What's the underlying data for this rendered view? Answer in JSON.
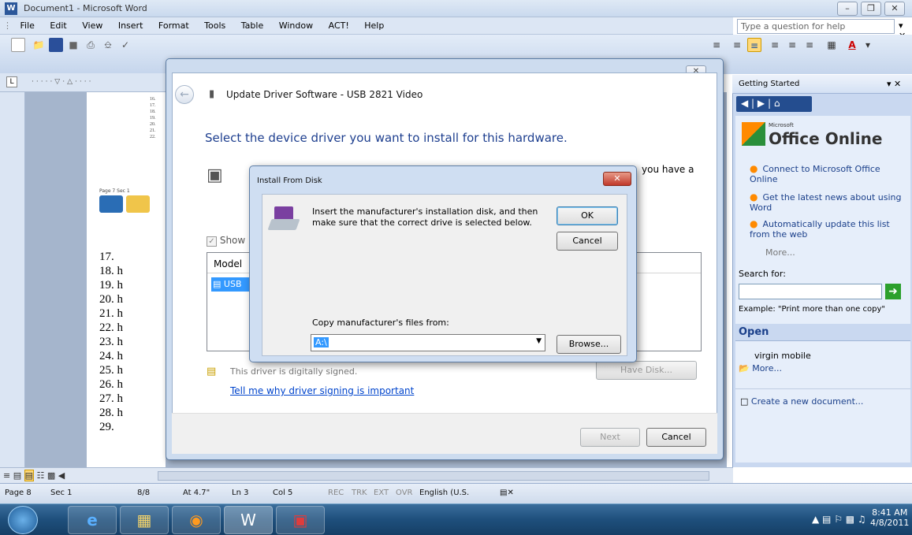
{
  "window": {
    "title": "Document1 - Microsoft Word"
  },
  "menubar": {
    "items": [
      "File",
      "Edit",
      "View",
      "Insert",
      "Format",
      "Tools",
      "Table",
      "Window",
      "ACT!",
      "Help"
    ]
  },
  "help_box": {
    "placeholder": "Type a question for help"
  },
  "document": {
    "thumb_lines": [
      "16.",
      "17.",
      "18.",
      "19.",
      "20.",
      "21.",
      "22."
    ],
    "lines": [
      "17.",
      "18. h",
      "19. h",
      "20. h",
      "21. h",
      "22. h",
      "23. h",
      "24. h",
      "25. h",
      "26. h",
      "27. h",
      "28. h",
      "29."
    ],
    "thumb_status": [
      "Page 7",
      "Sec 1"
    ]
  },
  "wizard": {
    "title": "Update Driver Software - USB 2821 Video",
    "heading": "Select the device driver you want to install for this hardware.",
    "desc_fragment": "you have a",
    "show_compatible": "Show",
    "model_header": "Model",
    "model_item": "USB",
    "signed_text": "This driver is digitally signed.",
    "have_disk": "Have Disk...",
    "sign_link": "Tell me why driver signing is important",
    "next": "Next",
    "cancel": "Cancel"
  },
  "install_dialog": {
    "title": "Install From Disk",
    "message": "Insert the manufacturer's installation disk, and then make sure that the correct drive is selected below.",
    "ok": "OK",
    "cancel": "Cancel",
    "copy_label": "Copy manufacturer's files from:",
    "path_value": "A:\\",
    "browse": "Browse..."
  },
  "task_pane": {
    "header": "Getting Started",
    "logo": "Office Online",
    "logo_small": "Microsoft",
    "links": [
      "Connect to Microsoft Office Online",
      "Get the latest news about using Word",
      "Automatically update this list from the web"
    ],
    "more": "More...",
    "search_label": "Search for:",
    "example": "Example:  \"Print more than one copy\"",
    "open_header": "Open",
    "recent": "virgin mobile",
    "open_more": "More...",
    "new_doc": "Create a new document..."
  },
  "statusbar": {
    "page": "Page 8",
    "sec": "Sec 1",
    "pages": "8/8",
    "at": "At 4.7\"",
    "ln": "Ln 3",
    "col": "Col 5",
    "rec": "REC",
    "trk": "TRK",
    "ext": "EXT",
    "ovr": "OVR",
    "lang": "English (U.S."
  },
  "clock": {
    "time": "8:41 AM",
    "date": "4/8/2011"
  }
}
